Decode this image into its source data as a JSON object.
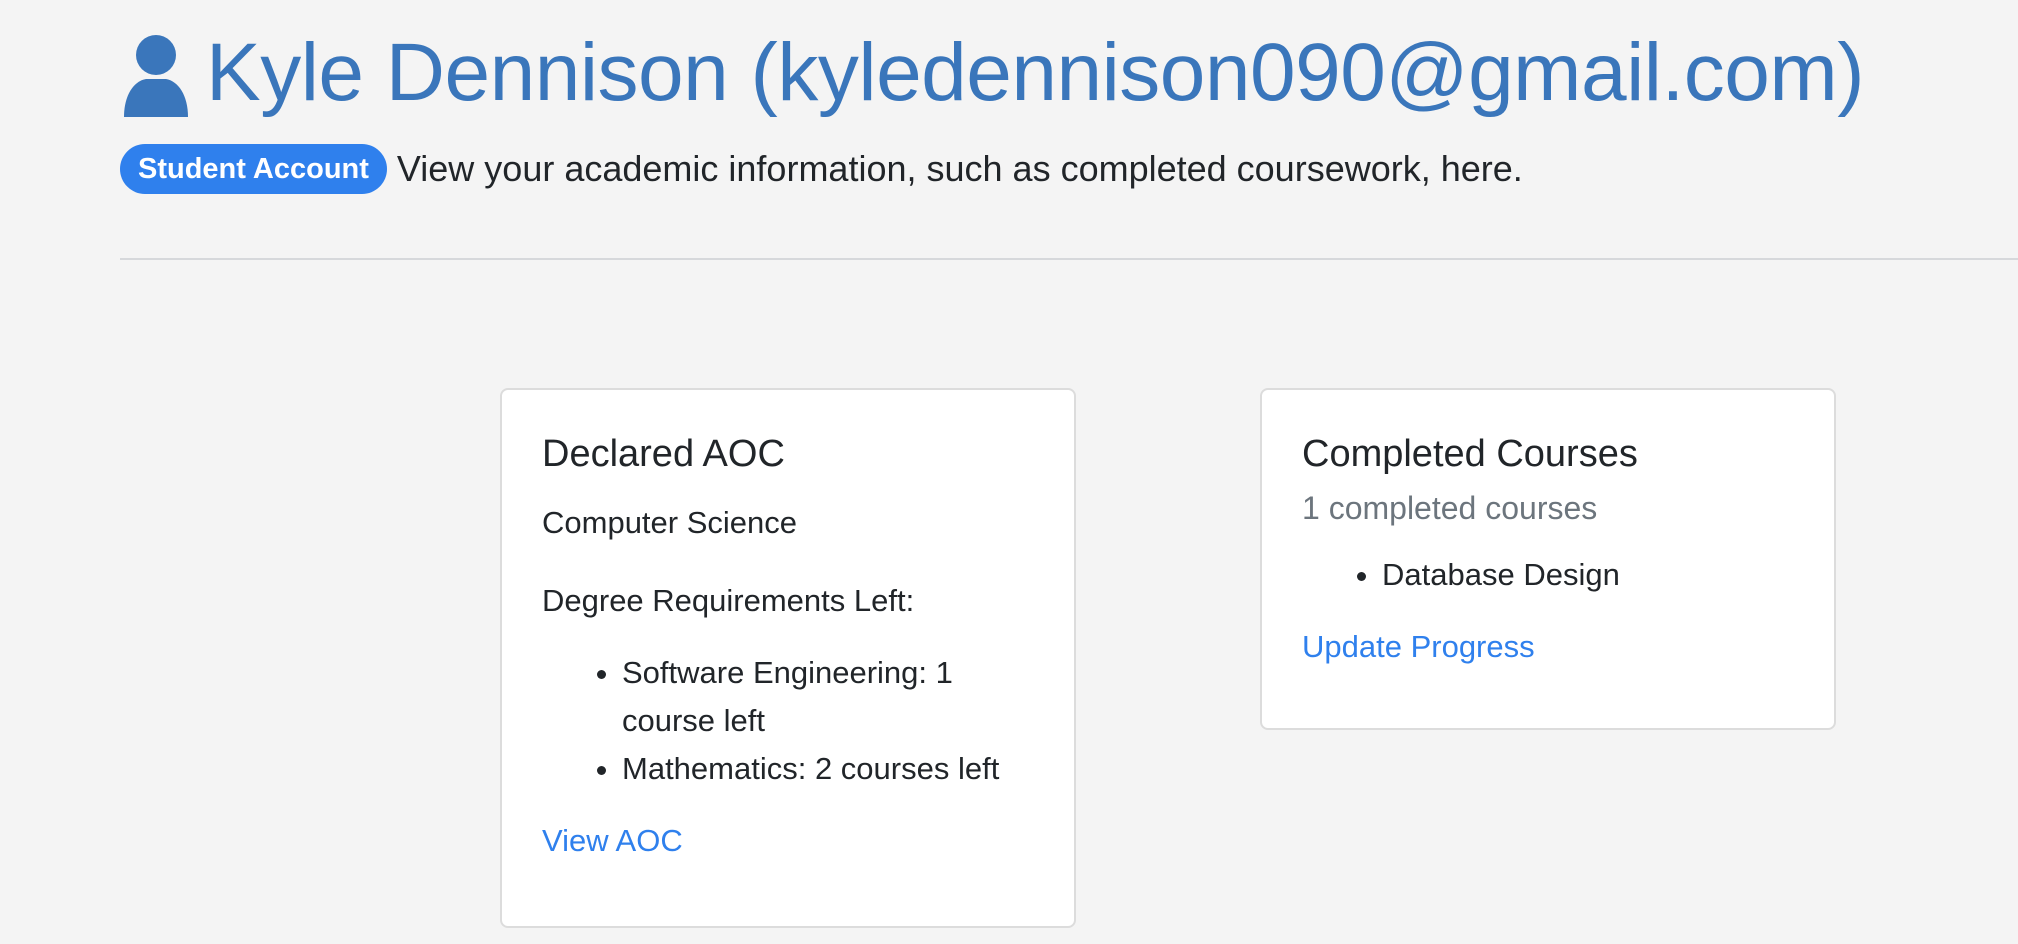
{
  "header": {
    "title": "Kyle Dennison (kyledennison090@gmail.com)",
    "badge": "Student Account",
    "subtitle": "View your academic information, such as completed coursework, here.",
    "icon": "user-icon"
  },
  "aoc_card": {
    "title": "Declared AOC",
    "aoc_name": "Computer Science",
    "requirements_label": "Degree Requirements Left:",
    "requirements": [
      "Software Engineering: 1 course left",
      "Mathematics: 2 courses left"
    ],
    "link_label": "View AOC"
  },
  "courses_card": {
    "title": "Completed Courses",
    "count_text": "1 completed courses",
    "courses": [
      "Database Design"
    ],
    "link_label": "Update Progress"
  },
  "colors": {
    "title_blue": "#3a76bb",
    "accent_blue": "#2f80ed",
    "background": "#f4f4f4",
    "muted_text": "#6c757d"
  }
}
